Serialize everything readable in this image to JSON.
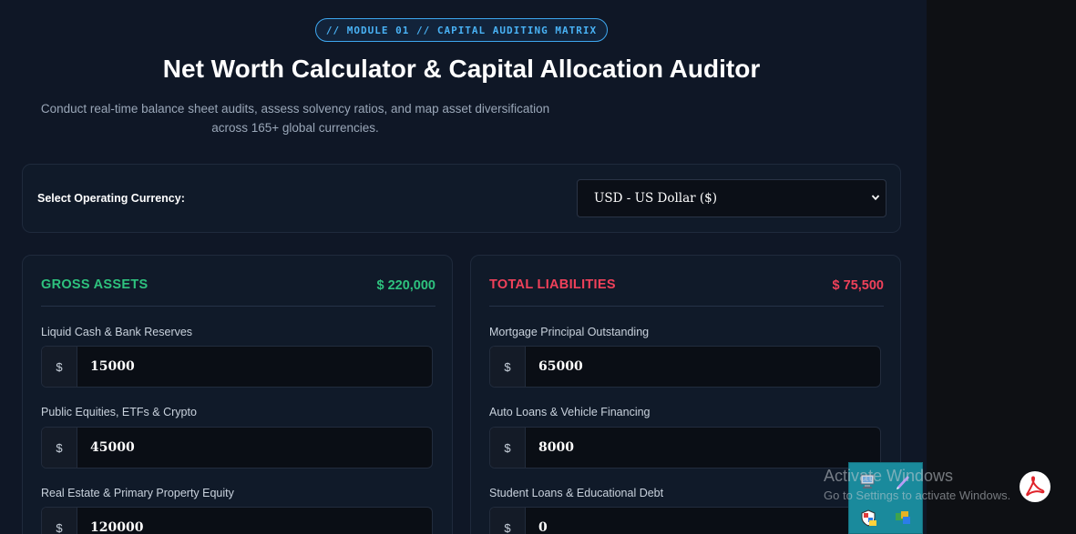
{
  "header": {
    "badge": "// MODULE 01 // CAPITAL AUDITING MATRIX",
    "title": "Net Worth Calculator & Capital Allocation Auditor",
    "subtitle_line1": "Conduct real-time balance sheet audits, assess solvency ratios, and map asset diversification",
    "subtitle_line2": "across 165+ global currencies."
  },
  "currency": {
    "label": "Select Operating Currency:",
    "selected": "USD - US Dollar ($)"
  },
  "assets": {
    "title": "GROSS ASSETS",
    "total": "$ 220,000",
    "fields": [
      {
        "label": "Liquid Cash & Bank Reserves",
        "prefix": "$",
        "value": "15000"
      },
      {
        "label": "Public Equities, ETFs & Crypto",
        "prefix": "$",
        "value": "45000"
      },
      {
        "label": "Real Estate & Primary Property Equity",
        "prefix": "$",
        "value": "120000"
      }
    ]
  },
  "liabilities": {
    "title": "TOTAL LIABILITIES",
    "total": "$ 75,500",
    "fields": [
      {
        "label": "Mortgage Principal Outstanding",
        "prefix": "$",
        "value": "65000"
      },
      {
        "label": "Auto Loans & Vehicle Financing",
        "prefix": "$",
        "value": "8000"
      },
      {
        "label": "Student Loans & Educational Debt",
        "prefix": "$",
        "value": "0"
      }
    ]
  },
  "windows_overlay": {
    "title": "Activate Windows",
    "subtitle": "Go to Settings to activate Windows."
  },
  "tray_icons": [
    "computer-icon",
    "pen-icon",
    "shield-icon",
    "apps-icon"
  ],
  "colors": {
    "accent_blue": "#49b2f5",
    "assets_green": "#2ec27e",
    "liabilities_red": "#f0415a",
    "background": "#0f1726"
  }
}
